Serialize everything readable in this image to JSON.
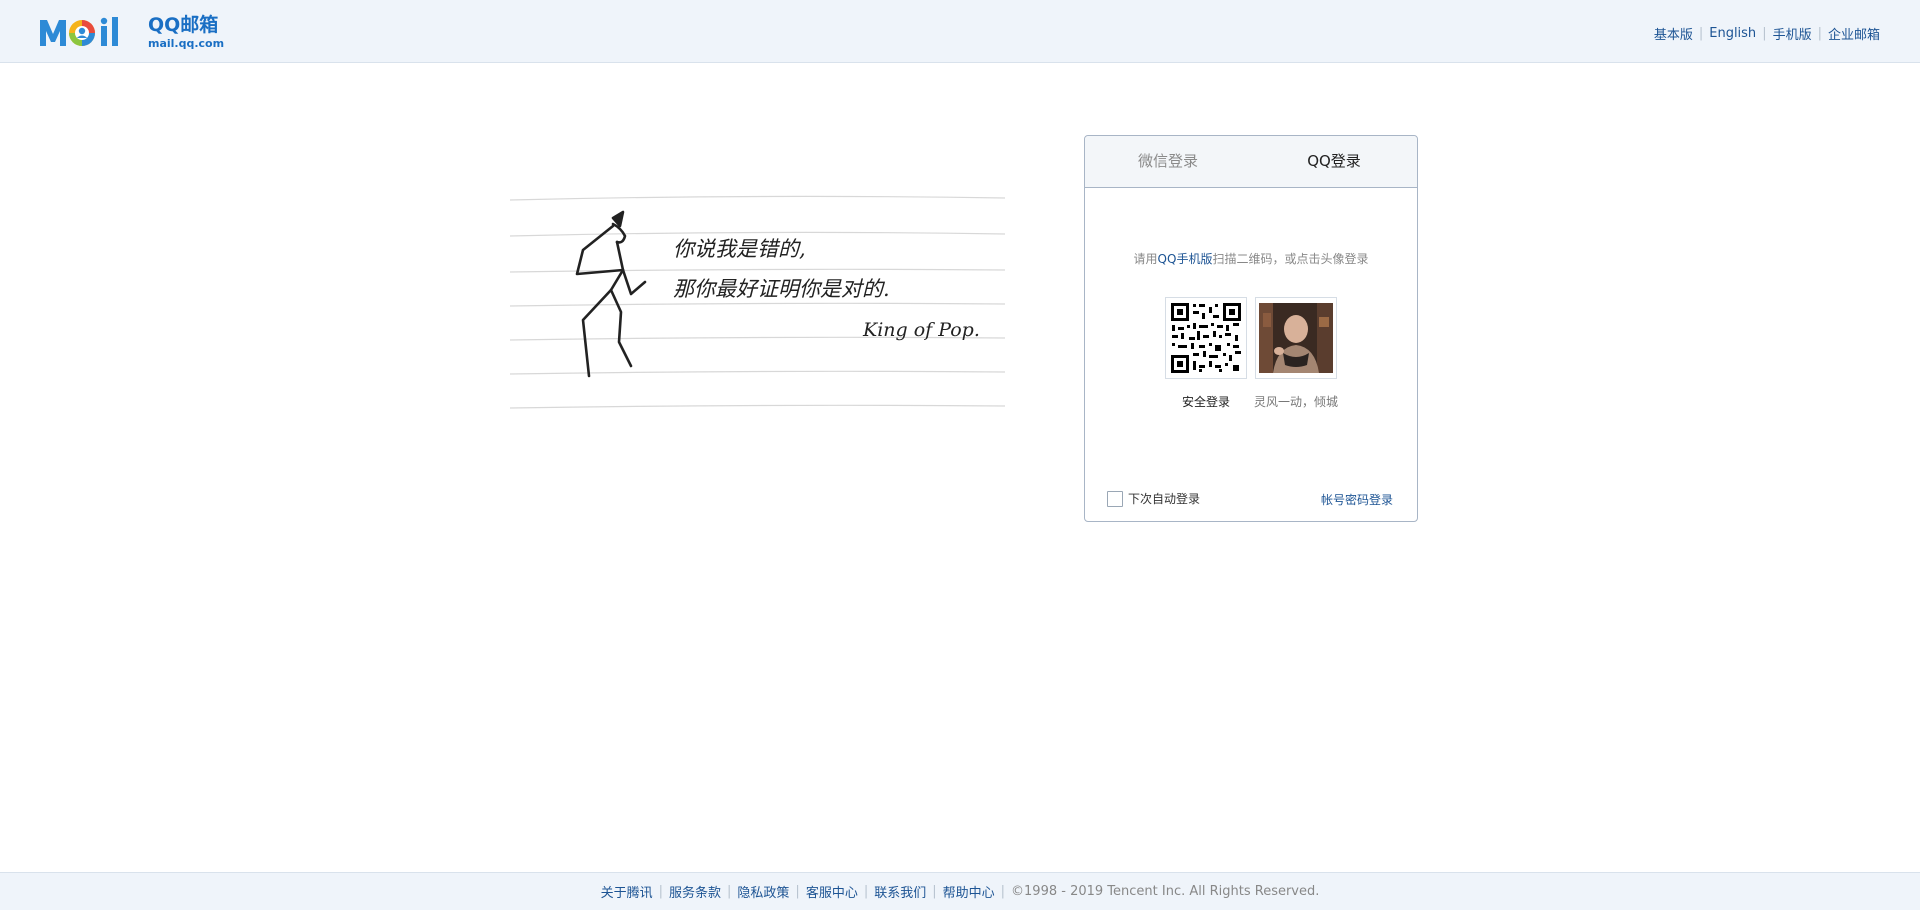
{
  "header": {
    "logo": {
      "wordmark": "Mail",
      "name": "QQ邮箱",
      "domain": "mail.qq.com"
    },
    "links": [
      "基本版",
      "English",
      "手机版",
      "企业邮箱"
    ]
  },
  "illustration": {
    "lines": [
      "你说我是错的,",
      "那你最好证明你是对的."
    ],
    "signature": "King of Pop."
  },
  "login": {
    "tabs": {
      "wechat": "微信登录",
      "qq": "QQ登录"
    },
    "hint": {
      "prefix": "请用",
      "link": "QQ手机版",
      "suffix": "扫描二维码，或点击头像登录"
    },
    "cards": {
      "qr_label": "安全登录",
      "avatar_label": "灵风一动，倾城"
    },
    "auto_login_label": "下次自动登录",
    "password_login_label": "帐号密码登录"
  },
  "footer": {
    "links": [
      "关于腾讯",
      "服务条款",
      "隐私政策",
      "客服中心",
      "联系我们",
      "帮助中心"
    ],
    "copyright": "©1998 - 2019 Tencent Inc. All Rights Reserved."
  },
  "colors": {
    "brand_blue": "#1a6fc4",
    "link_blue": "#1d5494",
    "header_bg": "#eff4fa",
    "panel_border": "#a8b5c6"
  }
}
